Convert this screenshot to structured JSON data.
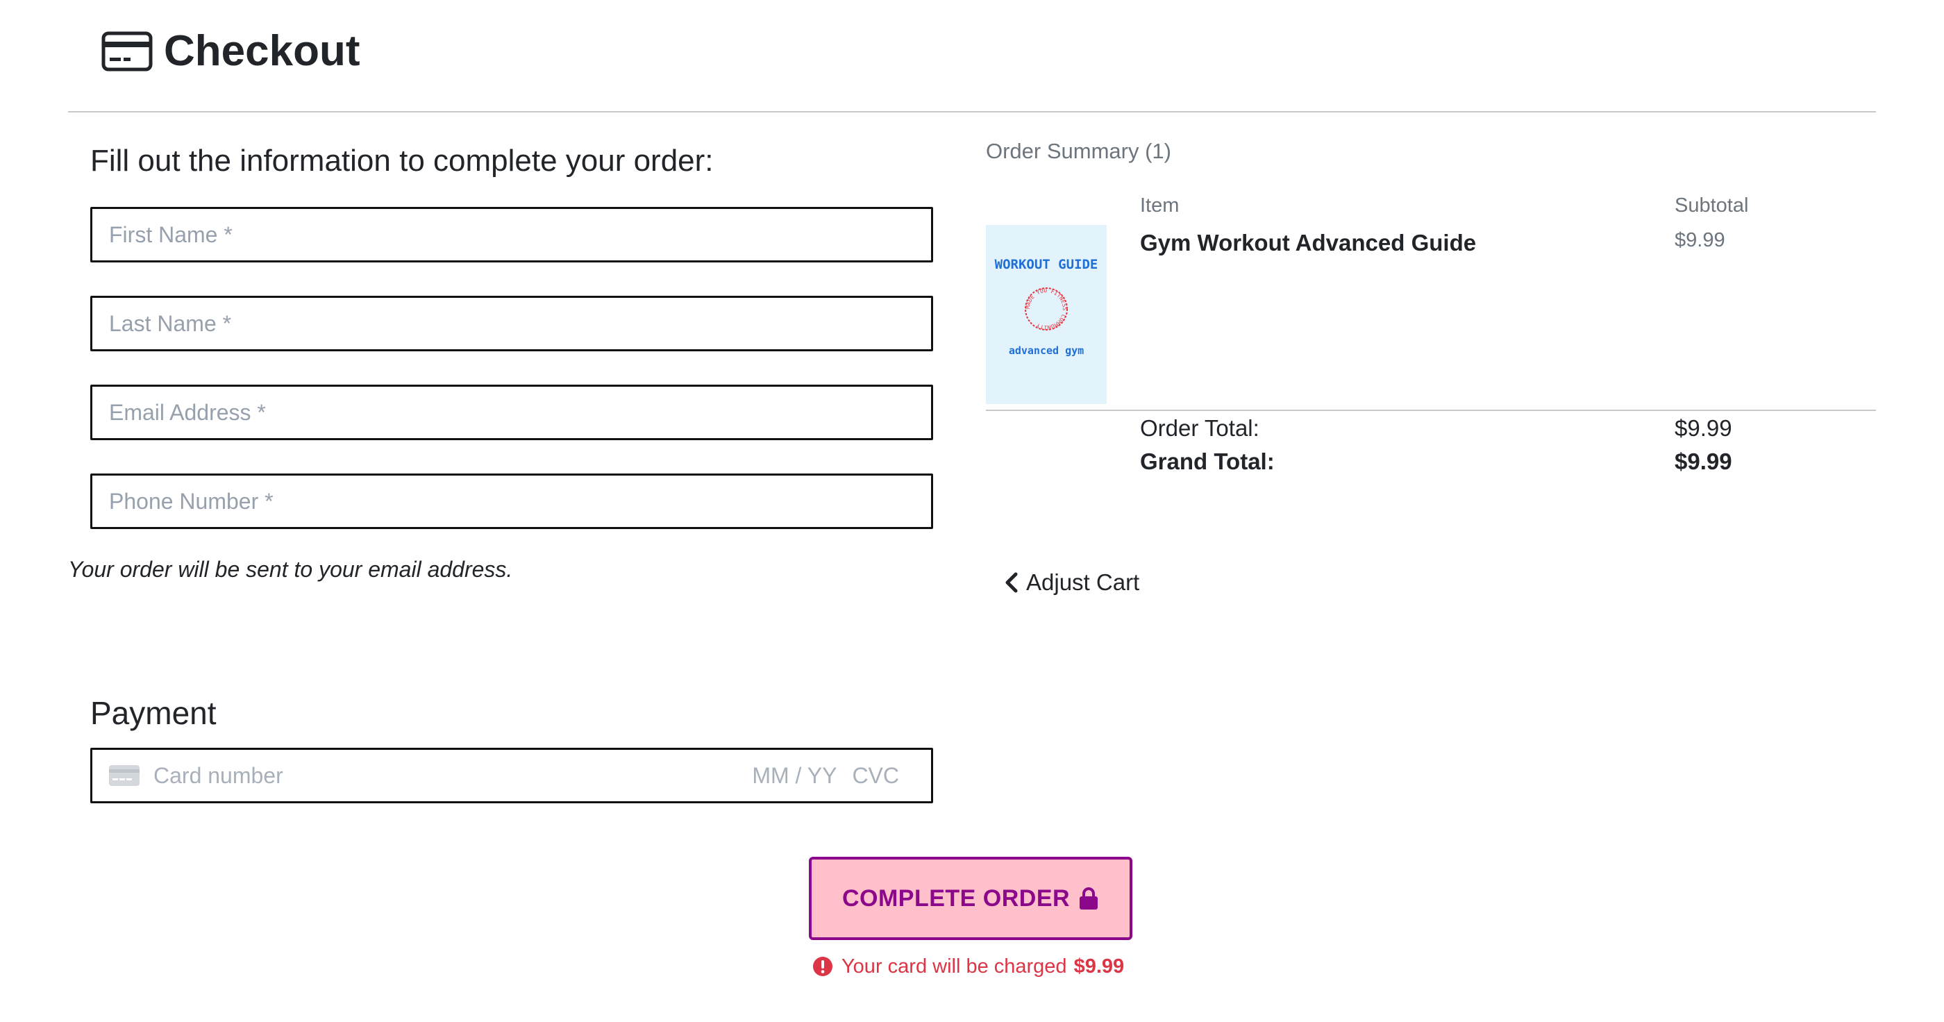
{
  "header": {
    "title": "Checkout",
    "icon": "credit-card-icon"
  },
  "form": {
    "title": "Fill out the information to complete your order:",
    "first_name_placeholder": "First Name *",
    "last_name_placeholder": "Last Name *",
    "email_placeholder": "Email Address *",
    "phone_placeholder": "Phone Number *",
    "note": "Your order will be sent to your email address."
  },
  "payment": {
    "title": "Payment",
    "card_number_placeholder": "Card number",
    "expiry_placeholder": "MM / YY",
    "cvc_placeholder": "CVC"
  },
  "summary": {
    "title": "Order Summary (1)",
    "col_item": "Item",
    "col_subtotal": "Subtotal",
    "items": [
      {
        "name": "Gym Workout Advanced Guide",
        "price": "$9.99",
        "image_texts": [
          "WORKOUT GUIDE",
          "MADE YOU FITNESS COMMUNITY",
          "advanced gym"
        ]
      }
    ],
    "order_total_label": "Order Total:",
    "order_total_value": "$9.99",
    "grand_total_label": "Grand Total:",
    "grand_total_value": "$9.99",
    "adjust_cart": "Adjust Cart"
  },
  "actions": {
    "complete_order": "COMPLETE ORDER",
    "charge_note": "Your card will be charged",
    "charge_amount": "$9.99"
  },
  "colors": {
    "button_bg": "#ffc0cb",
    "button_border": "#8b088b",
    "warning": "#dc3545",
    "muted": "#6c757d"
  }
}
